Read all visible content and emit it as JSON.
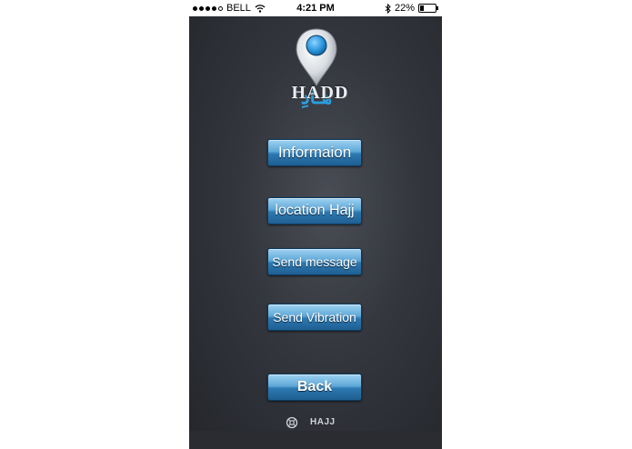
{
  "status_bar": {
    "carrier": "BELL",
    "time": "4:21 PM",
    "battery_percent": "22%",
    "battery_level": 0.22,
    "signal_bars": 4,
    "icons": [
      "signal-dots-icon",
      "wifi-icon",
      "bluetooth-icon",
      "battery-icon"
    ]
  },
  "logo": {
    "text": "HADD",
    "icon": "map-pin-icon",
    "accent_color": "#3fa6e0"
  },
  "menu": {
    "information_label": "Informaion",
    "location_label": "location Hajj",
    "send_message_label": "Send message",
    "send_vibration_label": "Send Vibration",
    "back_label": "Back"
  },
  "footer": {
    "text": "HAJJ",
    "icon": "lifebuoy-icon"
  },
  "colors": {
    "button_top": "#9fd2f1",
    "button_bottom": "#1f5f92",
    "background": "#33363d"
  }
}
